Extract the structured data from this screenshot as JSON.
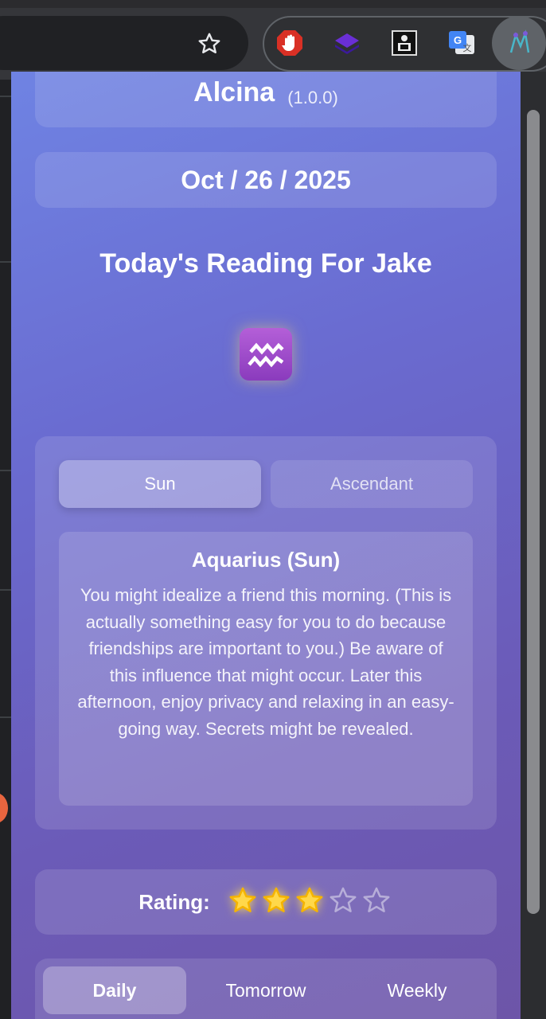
{
  "browser": {
    "bookmark_icon": "star-outline-icon",
    "extensions": [
      "stop-hand-icon",
      "layers-icon",
      "tarot-card-icon",
      "translate-icon",
      "zodiac-extension-icon"
    ]
  },
  "popup": {
    "app_name": "Alcina",
    "app_version": "(1.0.0)",
    "date": "Oct / 26 / 2025",
    "reading_title": "Today's Reading For Jake",
    "zodiac_icon": "aquarius-icon",
    "sign_tabs": [
      {
        "label": "Sun",
        "active": true
      },
      {
        "label": "Ascendant",
        "active": false
      }
    ],
    "horoscope": {
      "title": "Aquarius (Sun)",
      "text": "You might idealize a friend this morning. (This is actually something easy for you to do because friendships are important to you.) Be aware of this influence that might occur. Later this afternoon, enjoy privacy and relaxing in an easy-going way. Secrets might be revealed."
    },
    "rating": {
      "label": "Rating:",
      "value": 3,
      "max": 5
    },
    "period_tabs": [
      {
        "label": "Daily",
        "active": true
      },
      {
        "label": "Tomorrow",
        "active": false
      },
      {
        "label": "Weekly",
        "active": false
      }
    ]
  },
  "colors": {
    "star_filled": "#ffd84a",
    "accent_purple": "#8a3bbd"
  }
}
